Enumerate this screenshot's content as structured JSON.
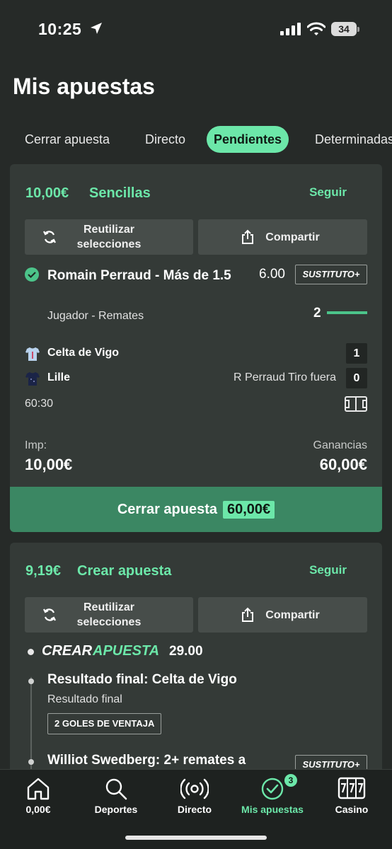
{
  "status": {
    "time": "10:25",
    "battery": "34"
  },
  "page": {
    "title": "Mis apuestas"
  },
  "tabs": [
    {
      "label": "Cerrar apuesta"
    },
    {
      "label": "Directo"
    },
    {
      "label": "Pendientes"
    },
    {
      "label": "Determinadas"
    }
  ],
  "bet1": {
    "stake": "10,00€",
    "type": "Sencillas",
    "follow": "Seguir",
    "reuse_line1": "Reutilizar",
    "reuse_line2": "selecciones",
    "share": "Compartir",
    "selection": "Romain Perraud - Más de 1.5",
    "odds": "6.00",
    "badge": "SUSTITUTO+",
    "market": "Jugador - Remates",
    "progress_value": "2",
    "progress_fraction": 1.0,
    "home_team": "Celta de Vigo",
    "home_score": "1",
    "away_team": "Lille",
    "away_event": "R Perraud Tiro fuera",
    "away_score": "0",
    "match_time": "60:30",
    "stake_label": "Imp:",
    "stake_value": "10,00€",
    "winnings_label": "Ganancias",
    "winnings_value": "60,00€",
    "cashout_label": "Cerrar apuesta",
    "cashout_amount": "60,00€"
  },
  "bet2": {
    "stake": "9,19€",
    "type": "Crear apuesta",
    "follow": "Seguir",
    "reuse_line1": "Reutilizar",
    "reuse_line2": "selecciones",
    "share": "Compartir",
    "bb_title_a": "CREAR",
    "bb_title_b": "APUESTA",
    "bb_odds": "29.00",
    "sel1": "Resultado final: Celta de Vigo",
    "sel1_market": "Resultado final",
    "sel1_pill": "2 GOLES DE VENTAJA",
    "sel2": "Williot Swedberg: 2+ remates a",
    "badge": "SUSTITUTO+"
  },
  "nav": {
    "balance": "0,00€",
    "sports": "Deportes",
    "live": "Directo",
    "mybets": "Mis apuestas",
    "mybets_badge": "3",
    "casino": "Casino"
  },
  "colors": {
    "accent": "#6ce7a9",
    "cashout": "#3b8763",
    "background": "#262a28",
    "card": "#343a37"
  }
}
